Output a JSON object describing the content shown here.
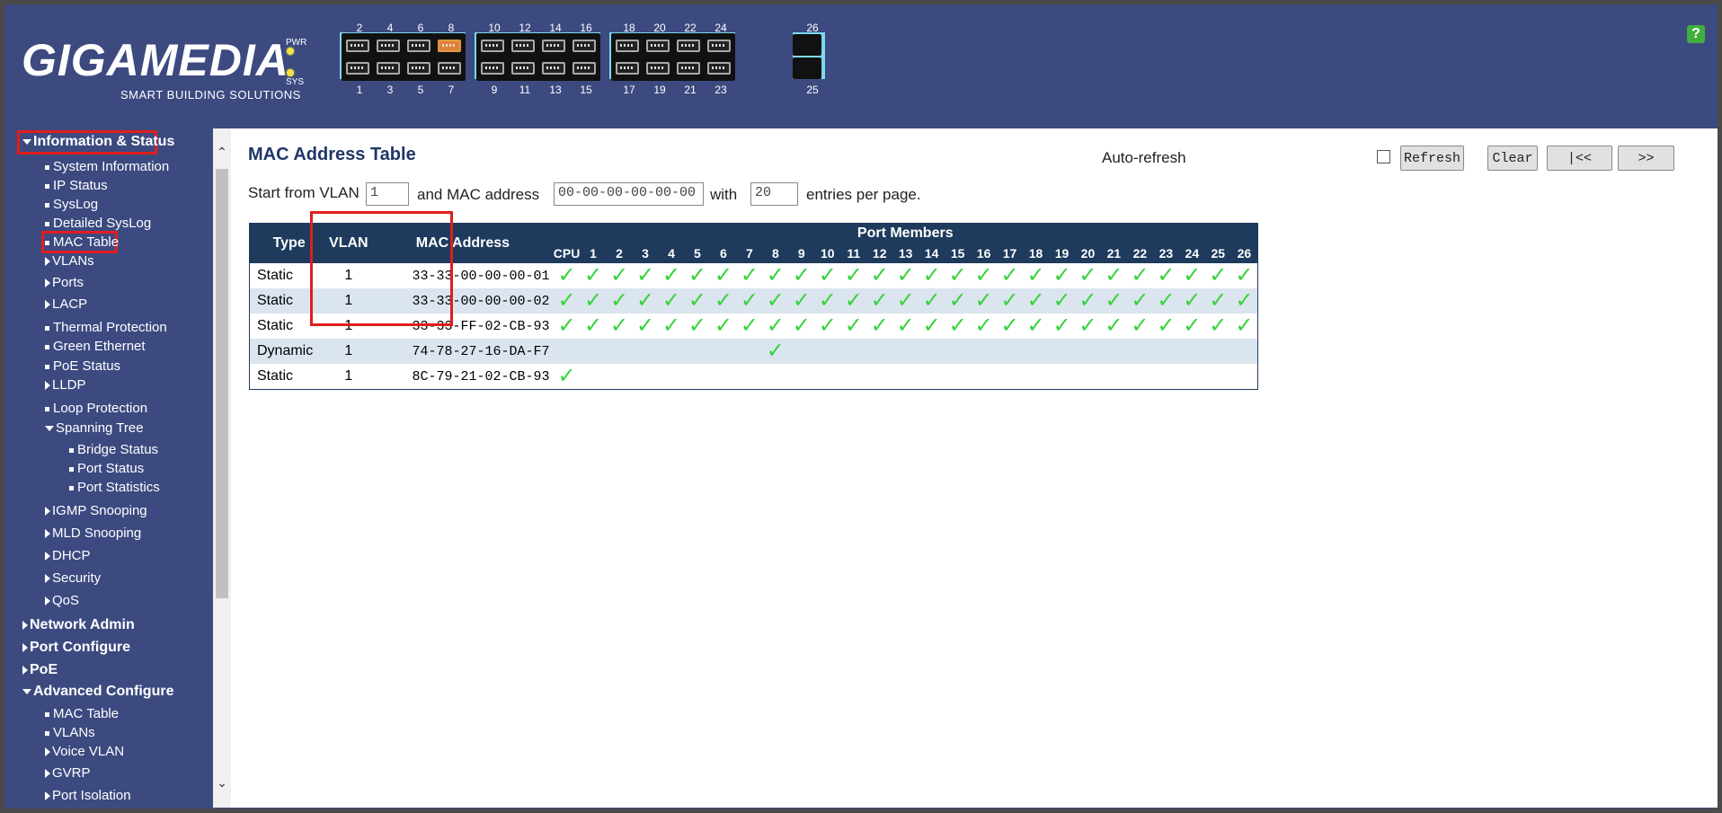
{
  "brand": {
    "logo": "GIGAMEDIA",
    "tagline": "SMART BUILDING SOLUTIONS"
  },
  "leds": {
    "pwr": "PWR",
    "sys": "SYS"
  },
  "ports_top": [
    "2",
    "4",
    "6",
    "8",
    "10",
    "12",
    "14",
    "16",
    "18",
    "20",
    "22",
    "24",
    "26"
  ],
  "ports_bottom": [
    "1",
    "3",
    "5",
    "7",
    "9",
    "11",
    "13",
    "15",
    "17",
    "19",
    "21",
    "23",
    "25"
  ],
  "help_label": "?",
  "sidebar": {
    "info_status": "Information & Status",
    "items": [
      "System Information",
      "IP Status",
      "SysLog",
      "Detailed SysLog",
      "MAC Table",
      "VLANs",
      "Ports",
      "LACP",
      "Thermal Protection",
      "Green Ethernet",
      "PoE Status",
      "LLDP",
      "Loop Protection",
      "Spanning Tree",
      "Bridge Status",
      "Port Status",
      "Port Statistics",
      "IGMP Snooping",
      "MLD Snooping",
      "DHCP",
      "Security",
      "QoS"
    ],
    "network_admin": "Network Admin",
    "port_configure": "Port Configure",
    "poe": "PoE",
    "advanced_configure": "Advanced Configure",
    "adv_items": [
      "MAC Table",
      "VLANs",
      "Voice VLAN",
      "GVRP",
      "Port Isolation"
    ]
  },
  "main": {
    "title": "MAC Address Table",
    "auto_refresh": "Auto-refresh",
    "buttons": {
      "refresh": "Refresh",
      "clear": "Clear",
      "first": "|<<",
      "next": ">>"
    },
    "filter": {
      "start_text": "Start from VLAN",
      "vlan_value": "1",
      "and_text": "and MAC address",
      "mac_value": "00-00-00-00-00-00",
      "with_text": "with",
      "entries_value": "20",
      "entries_text": "entries per page."
    },
    "table": {
      "headers": {
        "type": "Type",
        "vlan": "VLAN",
        "mac": "MAC Address",
        "port_members": "Port Members",
        "cpu": "CPU"
      },
      "port_cols": [
        "1",
        "2",
        "3",
        "4",
        "5",
        "6",
        "7",
        "8",
        "9",
        "10",
        "11",
        "12",
        "13",
        "14",
        "15",
        "16",
        "17",
        "18",
        "19",
        "20",
        "21",
        "22",
        "23",
        "24",
        "25",
        "26"
      ],
      "rows": [
        {
          "type": "Static",
          "vlan": "1",
          "mac": "33-33-00-00-00-01",
          "members": "all"
        },
        {
          "type": "Static",
          "vlan": "1",
          "mac": "33-33-00-00-00-02",
          "members": "all"
        },
        {
          "type": "Static",
          "vlan": "1",
          "mac": "33-33-FF-02-CB-93",
          "members": "all"
        },
        {
          "type": "Dynamic",
          "vlan": "1",
          "mac": "74-78-27-16-DA-F7",
          "members": "8"
        },
        {
          "type": "Static",
          "vlan": "1",
          "mac": "8C-79-21-02-CB-93",
          "members": "CPU"
        }
      ],
      "check_glyph": "✓"
    }
  },
  "colors": {
    "header_bg": "#3c4a80",
    "table_header": "#1e3a5c",
    "highlight": "#e01d1d",
    "check": "#35d43a"
  }
}
